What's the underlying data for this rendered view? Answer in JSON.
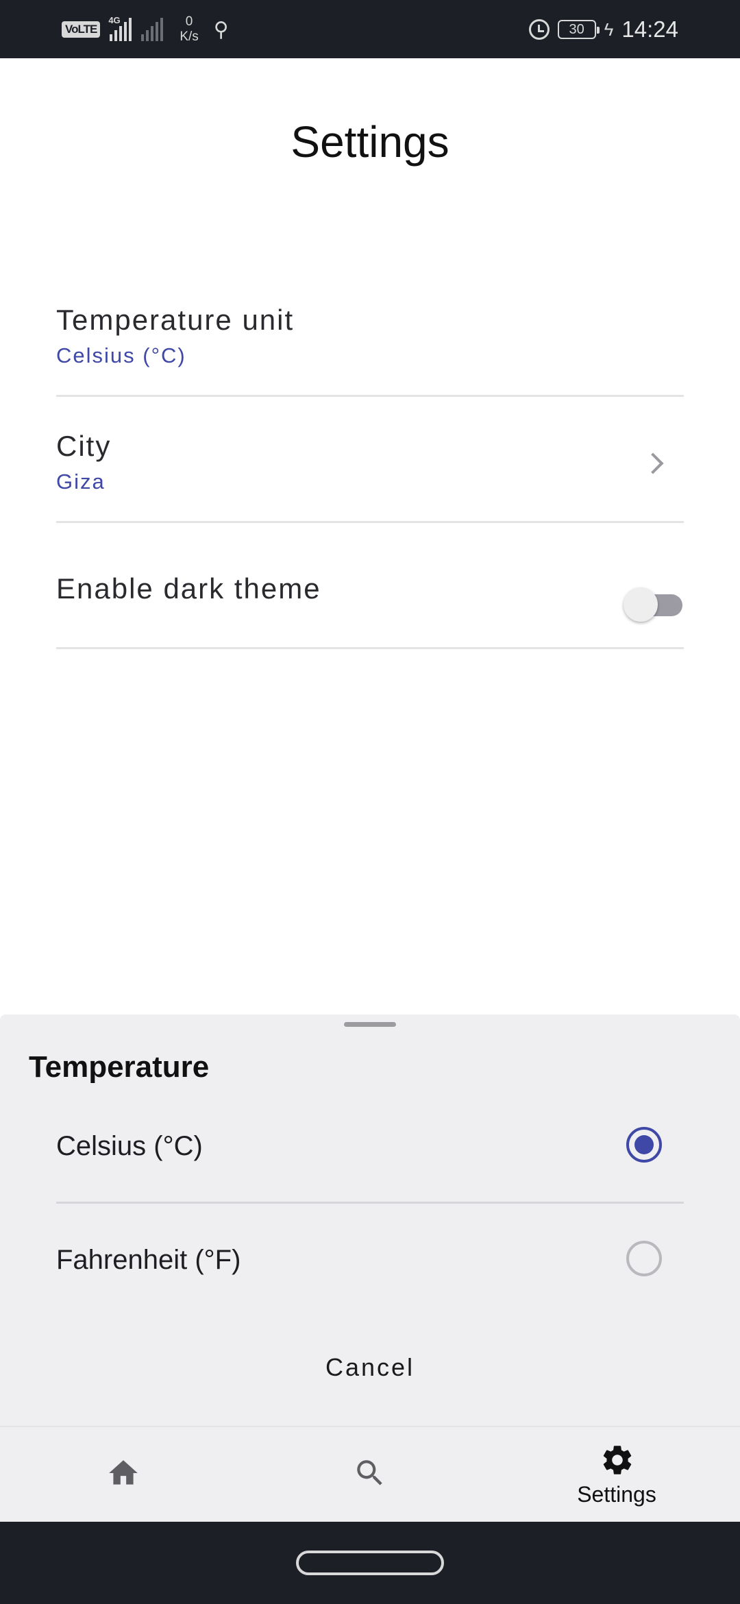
{
  "status_bar": {
    "volte": "VoLTE",
    "network_type": "4G",
    "speed_value": "0",
    "speed_unit": "K/s",
    "battery": "30",
    "time": "14:24"
  },
  "page": {
    "title": "Settings"
  },
  "settings": {
    "temperature": {
      "title": "Temperature unit",
      "value": "Celsius (°C)"
    },
    "city": {
      "title": "City",
      "value": "Giza"
    },
    "dark_theme": {
      "title": "Enable dark theme",
      "enabled": false
    }
  },
  "sheet": {
    "title": "Temperature",
    "options": [
      {
        "label": "Celsius (°C)",
        "selected": true
      },
      {
        "label": "Fahrenheit (°F)",
        "selected": false
      }
    ],
    "cancel_label": "Cancel"
  },
  "bottom_nav": {
    "items": [
      {
        "icon": "home-icon",
        "label": ""
      },
      {
        "icon": "search-icon",
        "label": ""
      },
      {
        "icon": "settings-icon",
        "label": "Settings",
        "active": true
      }
    ]
  },
  "colors": {
    "accent": "#3f48a6",
    "status_bar_bg": "#1c1f26",
    "sheet_bg": "#efeff2"
  }
}
